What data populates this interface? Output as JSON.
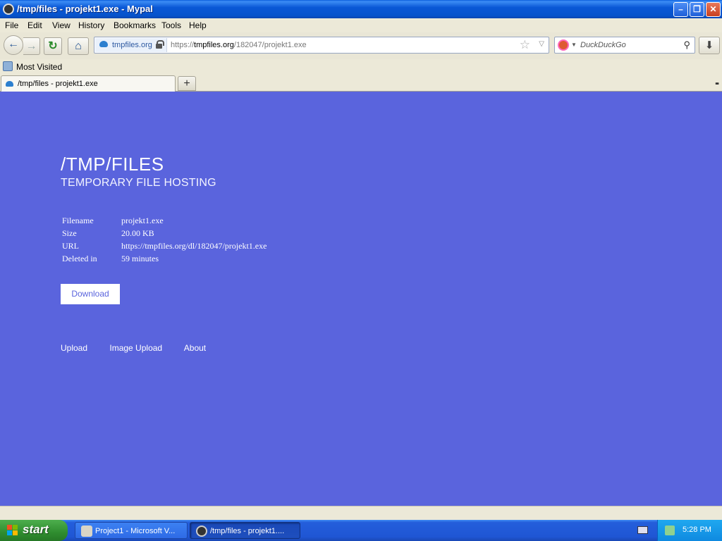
{
  "window": {
    "title": "/tmp/files - projekt1.exe - Mypal",
    "minimize_glyph": "–",
    "restore_glyph": "❐",
    "close_glyph": "✕"
  },
  "menu": [
    "File",
    "Edit",
    "View",
    "History",
    "Bookmarks",
    "Tools",
    "Help"
  ],
  "nav": {
    "back_glyph": "←",
    "forward_glyph": "→",
    "reload_glyph": "↻",
    "home_glyph": "⌂",
    "identity_site": "tmpfiles.org",
    "url_prefix": "https://",
    "url_host": "tmpfiles.org",
    "url_path": "/182047/projekt1.exe",
    "star_glyph": "☆",
    "url_dropdown_glyph": "▽",
    "search_placeholder": "DuckDuckGo",
    "search_dropdown_glyph": "▼",
    "search_glyph": "⚲",
    "download_glyph": "⬇"
  },
  "bookmarks": {
    "most_visited": "Most Visited"
  },
  "tabs": {
    "active_label": "/tmp/files - projekt1.exe",
    "new_tab_glyph": "+",
    "tab_list_glyph": "▪▪"
  },
  "page": {
    "title": "/TMP/FILES",
    "subtitle": "TEMPORARY FILE HOSTING",
    "info": [
      {
        "key": "Filename",
        "value": "projekt1.exe"
      },
      {
        "key": "Size",
        "value": "20.00 KB"
      },
      {
        "key": "URL",
        "value": "https://tmpfiles.org/dl/182047/projekt1.exe"
      },
      {
        "key": "Deleted in",
        "value": "59 minutes"
      }
    ],
    "download_label": "Download",
    "footer_links": [
      "Upload",
      "Image Upload",
      "About"
    ]
  },
  "taskbar": {
    "start_label": "start",
    "tasks": [
      {
        "label": "Project1 - Microsoft V..."
      },
      {
        "label": "/tmp/files - projekt1...."
      }
    ],
    "clock": "5:28 PM"
  },
  "colors": {
    "page_background": "#5a64dd",
    "taskbar_blue": "#245edb",
    "start_green": "#2f8d2f"
  }
}
